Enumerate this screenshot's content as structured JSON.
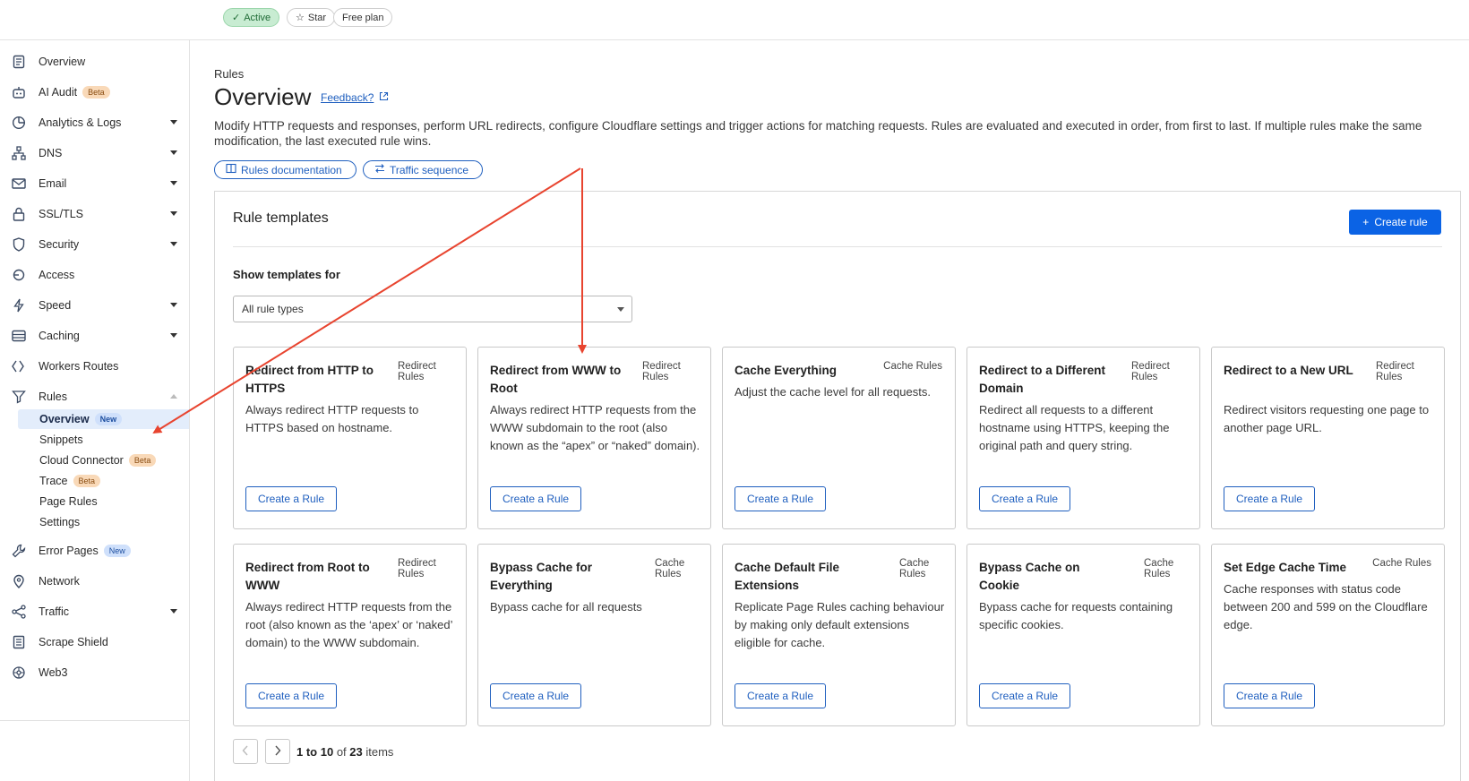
{
  "header": {
    "status": "Active",
    "star": "Star",
    "plan": "Free plan"
  },
  "sidebar": {
    "items": [
      {
        "label": "Overview",
        "icon": "document-icon"
      },
      {
        "label": "AI Audit",
        "icon": "robot-icon",
        "badge": "Beta"
      },
      {
        "label": "Analytics & Logs",
        "icon": "chart-icon"
      },
      {
        "label": "DNS",
        "icon": "network-tree-icon"
      },
      {
        "label": "Email",
        "icon": "email-icon"
      },
      {
        "label": "SSL/TLS",
        "icon": "lock-icon"
      },
      {
        "label": "Security",
        "icon": "shield-icon"
      },
      {
        "label": "Access",
        "icon": "access-icon"
      },
      {
        "label": "Speed",
        "icon": "lightning-icon"
      },
      {
        "label": "Caching",
        "icon": "storage-icon"
      },
      {
        "label": "Workers Routes",
        "icon": "workers-icon"
      },
      {
        "label": "Rules",
        "icon": "funnel-icon"
      },
      {
        "label": "Error Pages",
        "icon": "wrench-icon",
        "badge": "New"
      },
      {
        "label": "Network",
        "icon": "location-pin-icon"
      },
      {
        "label": "Traffic",
        "icon": "share-icon"
      },
      {
        "label": "Scrape Shield",
        "icon": "page-icon"
      },
      {
        "label": "Web3",
        "icon": "web3-icon"
      }
    ],
    "rules_subitems": [
      {
        "label": "Overview",
        "badge": "New"
      },
      {
        "label": "Snippets"
      },
      {
        "label": "Cloud Connector",
        "badge": "Beta"
      },
      {
        "label": "Trace",
        "badge": "Beta"
      },
      {
        "label": "Page Rules"
      },
      {
        "label": "Settings"
      }
    ]
  },
  "page": {
    "breadcrumb": "Rules",
    "title": "Overview",
    "feedback": "Feedback?",
    "description": "Modify HTTP requests and responses, perform URL redirects, configure Cloudflare settings and trigger actions for matching requests. Rules are evaluated and executed in order, from first to last. If multiple rules make the same modification, the last executed rule wins.",
    "rules_documentation": "Rules documentation",
    "traffic_sequence": "Traffic sequence"
  },
  "templates": {
    "heading": "Rule templates",
    "create_rule": "Create rule",
    "show_label": "Show templates for",
    "filter_value": "All rule types",
    "button_label": "Create a Rule",
    "cards": [
      {
        "title": "Redirect from HTTP to HTTPS",
        "type": "Redirect Rules",
        "desc": "Always redirect HTTP requests to HTTPS based on hostname."
      },
      {
        "title": "Redirect from WWW to Root",
        "type": "Redirect Rules",
        "desc": "Always redirect HTTP requests from the WWW subdomain to the root (also known as the “apex” or “naked” domain)."
      },
      {
        "title": "Cache Everything",
        "type": "Cache Rules",
        "desc": "Adjust the cache level for all requests."
      },
      {
        "title": "Redirect to a Different Domain",
        "type": "Redirect Rules",
        "desc": "Redirect all requests to a different hostname using HTTPS, keeping the original path and query string."
      },
      {
        "title": "Redirect to a New URL",
        "type": "Redirect Rules",
        "desc": "Redirect visitors requesting one page to another page URL."
      },
      {
        "title": "Redirect from Root to WWW",
        "type": "Redirect Rules",
        "desc": "Always redirect HTTP requests from the root (also known as the ‘apex’ or ‘naked’ domain) to the WWW subdomain."
      },
      {
        "title": "Bypass Cache for Everything",
        "type": "Cache Rules",
        "desc": "Bypass cache for all requests"
      },
      {
        "title": "Cache Default File Extensions",
        "type": "Cache Rules",
        "desc": "Replicate Page Rules caching behaviour by making only default extensions eligible for cache."
      },
      {
        "title": "Bypass Cache on Cookie",
        "type": "Cache Rules",
        "desc": "Bypass cache for requests containing specific cookies."
      },
      {
        "title": "Set Edge Cache Time",
        "type": "Cache Rules",
        "desc": "Cache responses with status code between 200 and 599 on the Cloudflare edge."
      }
    ]
  },
  "pagination": {
    "range": "1 to 10",
    "of": "of",
    "total": "23",
    "items": "items"
  },
  "annotation_color": "#e8442f"
}
